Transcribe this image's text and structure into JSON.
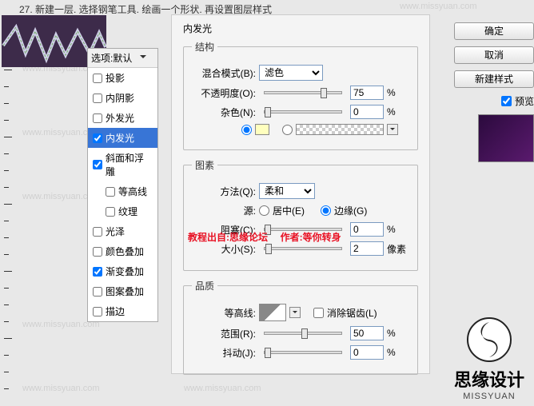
{
  "instruction": "27. 新建一层. 选择钢笔工具. 绘画一个形状. 再设置图层样式",
  "styles_header": "选项:默认",
  "styles": [
    {
      "label": "投影",
      "checked": false
    },
    {
      "label": "内阴影",
      "checked": false
    },
    {
      "label": "外发光",
      "checked": false
    },
    {
      "label": "内发光",
      "checked": true,
      "active": true
    },
    {
      "label": "斜面和浮雕",
      "checked": true
    },
    {
      "label": "等高线",
      "checked": false,
      "sub": true
    },
    {
      "label": "纹理",
      "checked": false,
      "sub": true
    },
    {
      "label": "光泽",
      "checked": false
    },
    {
      "label": "颜色叠加",
      "checked": false
    },
    {
      "label": "渐变叠加",
      "checked": true
    },
    {
      "label": "图案叠加",
      "checked": false
    },
    {
      "label": "描边",
      "checked": false
    }
  ],
  "panel": {
    "title": "内发光",
    "structure": {
      "legend": "结构",
      "blend_label": "混合模式(B):",
      "blend_value": "滤色",
      "opacity_label": "不透明度(O):",
      "opacity_value": "75",
      "pct": "%",
      "noise_label": "杂色(N):",
      "noise_value": "0",
      "color_hex": "#ffffbe"
    },
    "elements": {
      "legend": "图素",
      "method_label": "方法(Q):",
      "method_value": "柔和",
      "source_label": "源:",
      "source_center": "居中(E)",
      "source_edge": "边缘(G)",
      "choke_label": "阻塞(C):",
      "choke_value": "0",
      "size_label": "大小(S):",
      "size_value": "2",
      "px": "像素"
    },
    "quality": {
      "legend": "品质",
      "contour_label": "等高线:",
      "antialias": "消除锯齿(L)",
      "range_label": "范围(R):",
      "range_value": "50",
      "jitter_label": "抖动(J):",
      "jitter_value": "0"
    }
  },
  "buttons": {
    "ok": "确定",
    "cancel": "取消",
    "new_style": "新建样式",
    "preview": "预览"
  },
  "credit": {
    "source_label": "教程出自:",
    "source": "思缘论坛",
    "author_label": "作者:",
    "author": "等你转身"
  },
  "logo": {
    "text": "思缘设计",
    "sub": "MISSYUAN"
  },
  "watermark": "www.missyuan.com"
}
